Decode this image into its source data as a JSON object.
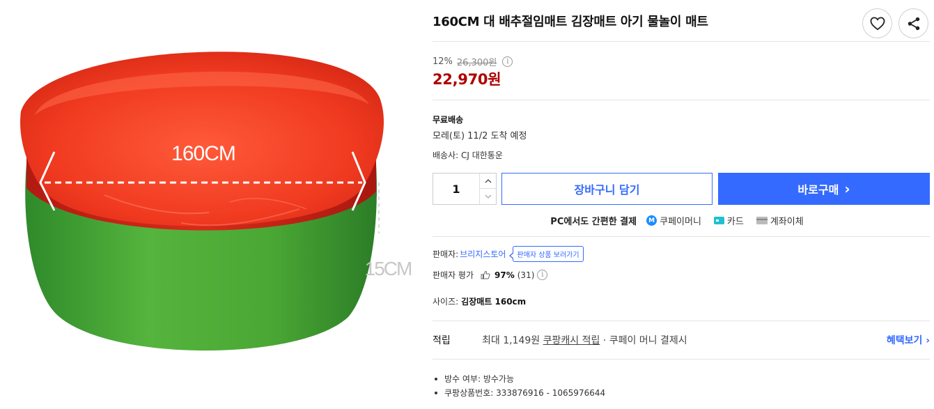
{
  "product": {
    "title": "160CM 대 배추절임매트 김장매트 아기 물놀이 매트",
    "image_labels": {
      "diameter": "160CM",
      "height": "15CM"
    }
  },
  "actions": {
    "wishlist_icon": "heart-icon",
    "share_icon": "share-icon"
  },
  "price": {
    "discount_rate": "12%",
    "original_price": "26,300원",
    "sale_price": "22,970원",
    "info_icon": "info-circle-icon"
  },
  "shipping": {
    "type": "무료배송",
    "arrival": "모레(토) 11/2 도착 예정",
    "courier": "배송사: CJ 대한통운"
  },
  "purchase": {
    "quantity": "1",
    "cart_label": "장바구니 담기",
    "buy_label": "바로구매",
    "buy_arrow": "›"
  },
  "payment": {
    "lead": "PC에서도 간편한 결제",
    "coupay_badge": "M",
    "coupay": "쿠페이머니",
    "card": "카드",
    "bank": "계좌이체"
  },
  "seller": {
    "label": "판매자:",
    "name": "브리지스토어",
    "tooltip": "판매자 상품 보러가기",
    "rating_label": "판매자 평가",
    "rating_pct": "97%",
    "rating_count": "(31)"
  },
  "option": {
    "label": "사이즈:",
    "value": "김장매트 160cm"
  },
  "reward": {
    "label": "적립",
    "prefix": "최대 1,149원 ",
    "link": "쿠팡캐시 적립",
    "suffix": " · 쿠페이 머니 결제시",
    "more": "혜택보기 ›"
  },
  "attributes": [
    "방수 여부: 방수가능",
    "쿠팡상품번호: 333876916 - 1065976644"
  ],
  "colors": {
    "accent_blue": "#346aff",
    "price_red": "#ae0000",
    "mat_red": "#e2361c",
    "mat_green": "#4aa734"
  }
}
